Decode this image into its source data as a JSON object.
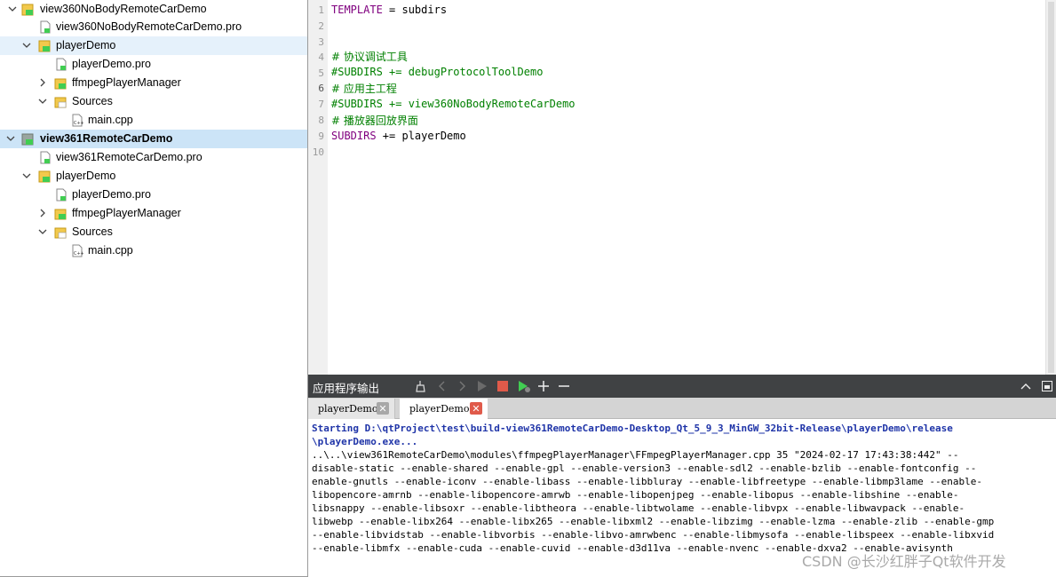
{
  "tree": {
    "items": [
      {
        "label": "view360NoBodyRemoteCarDemo",
        "bold": false
      },
      {
        "label": "view360NoBodyRemoteCarDemo.pro"
      },
      {
        "label": "playerDemo"
      },
      {
        "label": "playerDemo.pro"
      },
      {
        "label": "ffmpegPlayerManager"
      },
      {
        "label": "Sources"
      },
      {
        "label": "main.cpp"
      },
      {
        "label": "view361RemoteCarDemo",
        "bold": true
      },
      {
        "label": "view361RemoteCarDemo.pro"
      },
      {
        "label": "playerDemo"
      },
      {
        "label": "playerDemo.pro"
      },
      {
        "label": "ffmpegPlayerManager"
      },
      {
        "label": "Sources"
      },
      {
        "label": "main.cpp"
      }
    ]
  },
  "editor": {
    "line_numbers": [
      "1",
      "2",
      "3",
      "4",
      "5",
      "6",
      "7",
      "8",
      "9",
      "10"
    ],
    "current_line": "6",
    "lines": [
      {
        "kw": "TEMPLATE",
        "rest": " = subdirs"
      },
      {
        "text": ""
      },
      {
        "text": ""
      },
      {
        "comment": "# 协议调试工具"
      },
      {
        "comment": "#SUBDIRS += debugProtocolToolDemo"
      },
      {
        "comment": "# 应用主工程"
      },
      {
        "comment": "#SUBDIRS += view360NoBodyRemoteCarDemo"
      },
      {
        "comment": "# 播放器回放界面"
      },
      {
        "kw": "SUBDIRS",
        "rest": " += playerDemo"
      },
      {
        "text": ""
      }
    ]
  },
  "output": {
    "title": "应用程序输出",
    "tabs": [
      {
        "label": "playerDemo",
        "active": false
      },
      {
        "label": "playerDemo",
        "active": true
      }
    ],
    "lines": [
      {
        "text": "Starting D:\\qtProject\\test\\build-view361RemoteCarDemo-Desktop_Qt_5_9_3_MinGW_32bit-Release\\playerDemo\\release",
        "style": "blue"
      },
      {
        "text": "\\playerDemo.exe...",
        "style": "blue"
      },
      {
        "text": "..\\..\\view361RemoteCarDemo\\modules\\ffmpegPlayerManager\\FFmpegPlayerManager.cpp 35 \"2024-02-17 17:43:38:442\" --",
        "style": "plain"
      },
      {
        "text": "disable-static --enable-shared --enable-gpl --enable-version3 --enable-sdl2 --enable-bzlib --enable-fontconfig --",
        "style": "plain"
      },
      {
        "text": "enable-gnutls --enable-iconv --enable-libass --enable-libbluray --enable-libfreetype --enable-libmp3lame --enable-",
        "style": "plain"
      },
      {
        "text": "libopencore-amrnb --enable-libopencore-amrwb --enable-libopenjpeg --enable-libopus --enable-libshine --enable-",
        "style": "plain"
      },
      {
        "text": "libsnappy --enable-libsoxr --enable-libtheora --enable-libtwolame --enable-libvpx --enable-libwavpack --enable-",
        "style": "plain"
      },
      {
        "text": "libwebp --enable-libx264 --enable-libx265 --enable-libxml2 --enable-libzimg --enable-lzma --enable-zlib --enable-gmp",
        "style": "plain"
      },
      {
        "text": "--enable-libvidstab --enable-libvorbis --enable-libvo-amrwbenc --enable-libmysofa --enable-libspeex --enable-libxvid",
        "style": "plain"
      },
      {
        "text": "--enable-libmfx --enable-cuda --enable-cuvid --enable-d3d11va --enable-nvenc --enable-dxva2 --enable-avisynth",
        "style": "plain"
      }
    ]
  },
  "watermark": "CSDN @长沙红胖子Qt软件开发",
  "colors": {
    "keyword": "#80007f",
    "comment": "#008000",
    "output_header": "#404244",
    "starting_text": "#1f34a8",
    "selection": "#cce4f7",
    "hover": "#e5f1fb",
    "folder": "#f2c94c",
    "close_tab": "#e05a4a"
  },
  "icons": {
    "project": "qt-project-icon",
    "pro_file": "qt-pro-file-icon",
    "folder": "qt-folder-icon",
    "cpp_file": "cpp-file-icon"
  }
}
